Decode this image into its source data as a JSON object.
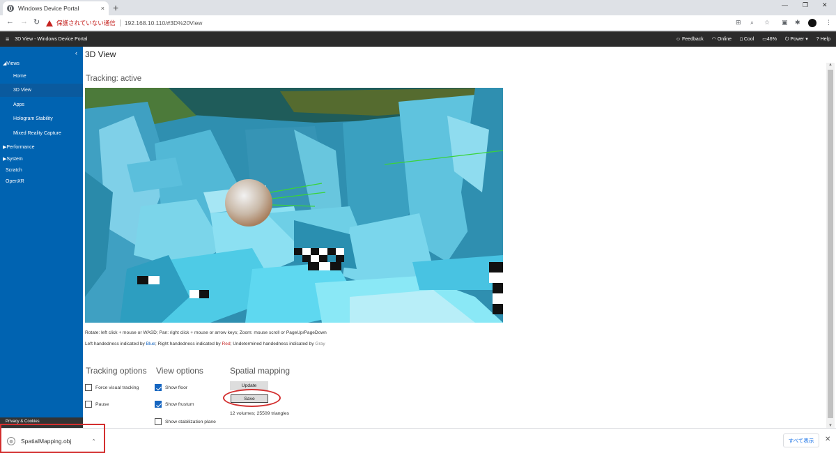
{
  "browser": {
    "tab_title": "Windows Device Portal",
    "new_tab": "+",
    "close_tab": "×",
    "url_warning": "保護されていない通信",
    "url": "192.168.10.110/#3D%20View",
    "back": "←",
    "forward": "→",
    "reload": "↻",
    "minimize": "—",
    "restore": "❐",
    "close_window": "✕"
  },
  "header": {
    "app_title": "3D View - Windows Device Portal",
    "menu_icon": "≡",
    "feedback": "Feedback",
    "online": "Online",
    "thermal": "Cool",
    "battery": "46%",
    "power": "Power ▾",
    "help": "Help"
  },
  "sidebar": {
    "collapse": "‹",
    "views": "◢Views",
    "home": "Home",
    "view3d": "3D View",
    "apps": "Apps",
    "hologram": "Hologram Stability",
    "mrc": "Mixed Reality Capture",
    "performance": "▶Performance",
    "system": "▶System",
    "scratch": "Scratch",
    "openxr": "OpenXR",
    "privacy": "Privacy & Cookies"
  },
  "main": {
    "title": "3D View",
    "tracking_status": "Tracking: active",
    "help_controls": "Rotate: left click + mouse or WASD; Pan: right click + mouse or arrow keys; Zoom: mouse scroll or PageUp/PageDown",
    "help_hand_pre": "Left handedness indicated by ",
    "help_hand_blue": "Blue",
    "help_hand_mid": "; Right handedness indicated by ",
    "help_hand_red": "Red",
    "help_hand_mid2": "; Undetermined handedness indicated by ",
    "help_hand_gray": "Gray",
    "tracking_options": {
      "heading": "Tracking options",
      "force_visual": "Force visual tracking",
      "force_visual_checked": false,
      "pause": "Pause",
      "pause_checked": false
    },
    "view_options": {
      "heading": "View options",
      "show_floor": "Show floor",
      "show_floor_checked": true,
      "show_frustum": "Show frustum",
      "show_frustum_checked": true,
      "show_stabilization": "Show stabilization plane",
      "show_stabilization_checked": false
    },
    "spatial_mapping": {
      "heading": "Spatial mapping",
      "update": "Update",
      "save": "Save",
      "stats": "12 volumes; 25509 triangles"
    }
  },
  "download_bar": {
    "file_name": "SpatialMapping.obj",
    "chevron": "⌃",
    "show_all": "すべて表示",
    "close": "✕"
  },
  "colors": {
    "sidebar": "#0063b1",
    "appbar": "#2b2b2b",
    "mesh": "#3aa8c8",
    "annotation": "#d32f2f"
  }
}
